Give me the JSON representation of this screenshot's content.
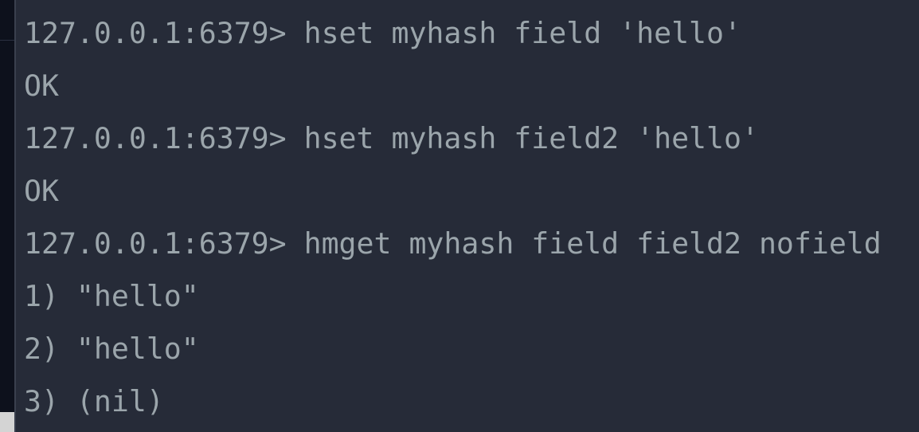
{
  "terminal": {
    "lines": [
      "127.0.0.1:6379> hset myhash field 'hello'",
      "OK",
      "127.0.0.1:6379> hset myhash field2 'hello'",
      "OK",
      "127.0.0.1:6379> hmget myhash field field2 nofield",
      "1) \"hello\"",
      "2) \"hello\"",
      "3) (nil)"
    ]
  }
}
